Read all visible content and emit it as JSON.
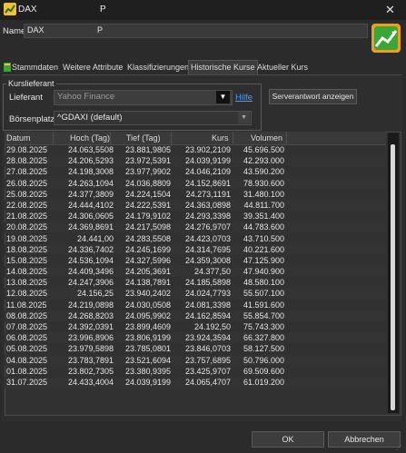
{
  "window": {
    "title": "DAX",
    "title_p": "P",
    "close": "✕"
  },
  "name_row": {
    "label": "Name",
    "value": "DAX",
    "value_p": "P"
  },
  "tabs": [
    {
      "label": "Stammdaten"
    },
    {
      "label": "Weitere Attribute"
    },
    {
      "label": "Klassifizierungen"
    },
    {
      "label": "Historische Kurse"
    },
    {
      "label": "Aktueller Kurs"
    }
  ],
  "kurslieferant": {
    "group_label": "Kurslieferant",
    "lieferant_label": "Lieferant",
    "lieferant_value": "Yahoo Finance",
    "hilfe": "Hilfe",
    "server_button": "Serverantwort anzeigen",
    "boerse_label": "Börsenplatz",
    "boerse_value": "^GDAXI (default)"
  },
  "table": {
    "headers": [
      "Datum",
      "Hoch (Tag)",
      "Tief (Tag)",
      "Kurs",
      "Volumen"
    ],
    "rows": [
      [
        "29.08.2025",
        "24.063,5508",
        "23.881,9805",
        "23.902,2109",
        "45.696.500"
      ],
      [
        "28.08.2025",
        "24.206,5293",
        "23.972,5391",
        "24.039,9199",
        "42.293.000"
      ],
      [
        "27.08.2025",
        "24.198,3008",
        "23.977,9902",
        "24.046,2109",
        "43.590.200"
      ],
      [
        "26.08.2025",
        "24.263,1094",
        "24.036,8809",
        "24.152,8691",
        "78.930.600"
      ],
      [
        "25.08.2025",
        "24.377,3809",
        "24.224,1504",
        "24.273,1191",
        "31.480.100"
      ],
      [
        "22.08.2025",
        "24.444,4102",
        "24.222,5391",
        "24.363,0898",
        "44.811.700"
      ],
      [
        "21.08.2025",
        "24.306,0605",
        "24.179,9102",
        "24.293,3398",
        "39.351.400"
      ],
      [
        "20.08.2025",
        "24.369,8691",
        "24.217,5098",
        "24.276,9707",
        "44.783.600"
      ],
      [
        "19.08.2025",
        "24.441,00",
        "24.283,5508",
        "24.423,0703",
        "43.710.500"
      ],
      [
        "18.08.2025",
        "24.336,7402",
        "24.245,1699",
        "24.314,7695",
        "40.221.600"
      ],
      [
        "15.08.2025",
        "24.536,1094",
        "24.327,5996",
        "24.359,3008",
        "47.125.900"
      ],
      [
        "14.08.2025",
        "24.409,3496",
        "24.205,3691",
        "24.377,50",
        "47.940.900"
      ],
      [
        "13.08.2025",
        "24.247,3906",
        "24.138,7891",
        "24.185,5898",
        "48.580.100"
      ],
      [
        "12.08.2025",
        "24.156,25",
        "23.940,2402",
        "24.024,7793",
        "55.507.100"
      ],
      [
        "11.08.2025",
        "24.219,0898",
        "24.030,0508",
        "24.081,3398",
        "41.591.600"
      ],
      [
        "08.08.2025",
        "24.268,8203",
        "24.095,9902",
        "24.162,8594",
        "55.854.700"
      ],
      [
        "07.08.2025",
        "24.392,0391",
        "23.899,4609",
        "24.192,50",
        "75.743.300"
      ],
      [
        "06.08.2025",
        "23.996,8906",
        "23.806,9199",
        "23.924,3594",
        "66.327.800"
      ],
      [
        "05.08.2025",
        "23.979,5898",
        "23.785,0801",
        "23.846,0703",
        "58.127.500"
      ],
      [
        "04.08.2025",
        "23.783,7891",
        "23.521,6094",
        "23.757,6895",
        "50.796.000"
      ],
      [
        "01.08.2025",
        "23.802,7305",
        "23.380,9395",
        "23.425,9707",
        "69.509.600"
      ],
      [
        "31.07.2025",
        "24.433,4004",
        "24.039,9199",
        "24.065,4707",
        "61.019.200"
      ]
    ]
  },
  "buttons": {
    "ok": "OK",
    "cancel": "Abbrechen"
  }
}
